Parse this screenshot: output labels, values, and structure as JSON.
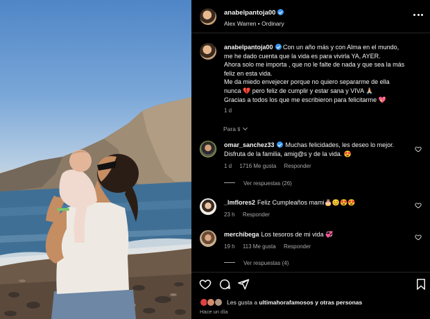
{
  "post": {
    "username": "anabelpantoja00",
    "audio": "Alex Warren • Ordinary",
    "caption_user": "anabelpantoja00",
    "caption_lines": [
      "Con un año más y con Alma en el mundo,",
      "me he dado cuenta que la vida es para vivirla YA, AYER.",
      "Ahora solo me importa , que no le falte de nada y que sea la más",
      "feliz en esta vida.",
      "Me da miedo envejecer porque no quiero separarme de ella",
      "nunca 💔 pero feliz de cumplir y estar sana y VIVA 🙏🏼",
      "Gracias a todos los que me escribieron para felicitarme 💖"
    ],
    "caption_time": "1 d",
    "translate_label": "Para ti"
  },
  "comments": [
    {
      "user": "omar_sanchez33",
      "verified": true,
      "text_lines": [
        "Muchas felicidades, les deseo lo mejor.",
        "Disfruta de la familia, amig@s y de la vida. 😍"
      ],
      "time": "1 d",
      "likes": "1716 Me gusta",
      "reply": "Responder",
      "view_replies": "Ver respuestas (26)"
    },
    {
      "user": "_lmflores2",
      "verified": false,
      "text_lines": [
        "Feliz Cumpleaños mami🎂😊😍😍"
      ],
      "time": "23 h",
      "likes": "",
      "reply": "Responder"
    },
    {
      "user": "merchibega",
      "verified": false,
      "text_lines": [
        "Los tesoros de mi vida 💞"
      ],
      "time": "19 h",
      "likes": "113 Me gusta",
      "reply": "Responder",
      "view_replies": "Ver respuestas (4)"
    }
  ],
  "footer": {
    "likes_prefix": "Les gusta a",
    "likes_user": "ultimahorafamosos",
    "likes_suffix": "y otras personas",
    "posted": "Hace un día"
  },
  "colors": {
    "background": "#000000",
    "text": "#f5f5f5",
    "secondary": "#a8a8a8",
    "verified": "#3897f0",
    "divider": "#262626"
  },
  "icons": [
    "more-icon",
    "heart-icon",
    "comment-icon",
    "share-icon",
    "bookmark-icon",
    "verified-icon",
    "chevron-down-icon"
  ]
}
